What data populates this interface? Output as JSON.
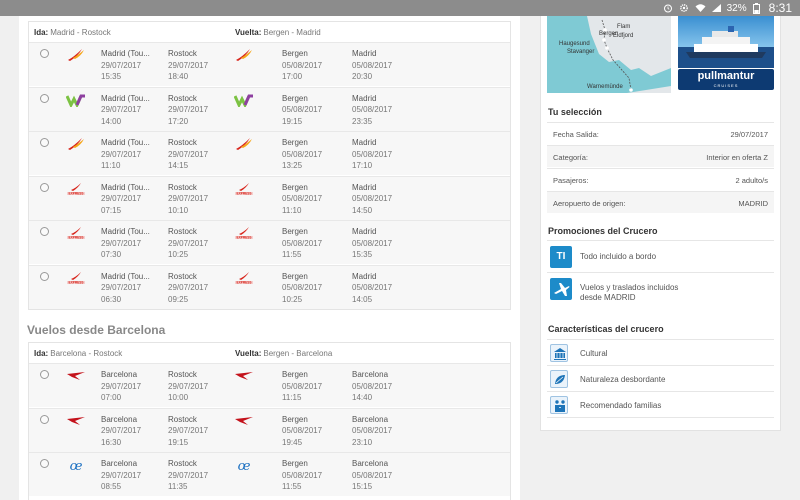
{
  "status_bar": {
    "battery": "32%",
    "time": "8:31"
  },
  "madrid_panel": {
    "ida_label": "Ida:",
    "ida_route": "Madrid - Rostock",
    "vuelta_label": "Vuelta:",
    "vuelta_route": "Bergen - Madrid",
    "rows": [
      {
        "airline_out": "iberia",
        "airline_ret": "iberia",
        "o_from": "Madrid (Tou...",
        "o_from_dt": "29/07/2017",
        "o_from_tm": "15:35",
        "o_to": "Rostock",
        "o_to_dt": "29/07/2017",
        "o_to_tm": "18:40",
        "r_from": "Bergen",
        "r_from_dt": "05/08/2017",
        "r_from_tm": "17:00",
        "r_to": "Madrid",
        "r_to_dt": "05/08/2017",
        "r_to_tm": "20:30"
      },
      {
        "airline_out": "vueling",
        "airline_ret": "vueling",
        "o_from": "Madrid (Tou...",
        "o_from_dt": "29/07/2017",
        "o_from_tm": "14:00",
        "o_to": "Rostock",
        "o_to_dt": "29/07/2017",
        "o_to_tm": "17:20",
        "r_from": "Bergen",
        "r_from_dt": "05/08/2017",
        "r_from_tm": "19:15",
        "r_to": "Madrid",
        "r_to_dt": "05/08/2017",
        "r_to_tm": "23:35"
      },
      {
        "airline_out": "iberia",
        "airline_ret": "iberia",
        "o_from": "Madrid (Tou...",
        "o_from_dt": "29/07/2017",
        "o_from_tm": "11:10",
        "o_to": "Rostock",
        "o_to_dt": "29/07/2017",
        "o_to_tm": "14:15",
        "r_from": "Bergen",
        "r_from_dt": "05/08/2017",
        "r_from_tm": "13:25",
        "r_to": "Madrid",
        "r_to_dt": "05/08/2017",
        "r_to_tm": "17:10"
      },
      {
        "airline_out": "iberia-express",
        "airline_ret": "iberia-express",
        "o_from": "Madrid (Tou...",
        "o_from_dt": "29/07/2017",
        "o_from_tm": "07:15",
        "o_to": "Rostock",
        "o_to_dt": "29/07/2017",
        "o_to_tm": "10:10",
        "r_from": "Bergen",
        "r_from_dt": "05/08/2017",
        "r_from_tm": "11:10",
        "r_to": "Madrid",
        "r_to_dt": "05/08/2017",
        "r_to_tm": "14:50"
      },
      {
        "airline_out": "iberia-express",
        "airline_ret": "iberia-express",
        "o_from": "Madrid (Tou...",
        "o_from_dt": "29/07/2017",
        "o_from_tm": "07:30",
        "o_to": "Rostock",
        "o_to_dt": "29/07/2017",
        "o_to_tm": "10:25",
        "r_from": "Bergen",
        "r_from_dt": "05/08/2017",
        "r_from_tm": "11:55",
        "r_to": "Madrid",
        "r_to_dt": "05/08/2017",
        "r_to_tm": "15:35"
      },
      {
        "airline_out": "iberia-express",
        "airline_ret": "iberia-express",
        "o_from": "Madrid (Tou...",
        "o_from_dt": "29/07/2017",
        "o_from_tm": "06:30",
        "o_to": "Rostock",
        "o_to_dt": "29/07/2017",
        "o_to_tm": "09:25",
        "r_from": "Bergen",
        "r_from_dt": "05/08/2017",
        "r_from_tm": "10:25",
        "r_to": "Madrid",
        "r_to_dt": "05/08/2017",
        "r_to_tm": "14:05"
      }
    ]
  },
  "barcelona_section_title": "Vuelos desde Barcelona",
  "barcelona_panel": {
    "ida_label": "Ida:",
    "ida_route": "Barcelona - Rostock",
    "vuelta_label": "Vuelta:",
    "vuelta_route": "Bergen - Barcelona",
    "rows": [
      {
        "airline_out": "air-europa-red",
        "airline_ret": "air-europa-red",
        "o_from": "Barcelona",
        "o_from_dt": "29/07/2017",
        "o_from_tm": "07:00",
        "o_to": "Rostock",
        "o_to_dt": "29/07/2017",
        "o_to_tm": "10:00",
        "r_from": "Bergen",
        "r_from_dt": "05/08/2017",
        "r_from_tm": "11:15",
        "r_to": "Barcelona",
        "r_to_dt": "05/08/2017",
        "r_to_tm": "14:40"
      },
      {
        "airline_out": "air-europa-red",
        "airline_ret": "air-europa-red",
        "o_from": "Barcelona",
        "o_from_dt": "29/07/2017",
        "o_from_tm": "16:30",
        "o_to": "Rostock",
        "o_to_dt": "29/07/2017",
        "o_to_tm": "19:15",
        "r_from": "Bergen",
        "r_from_dt": "05/08/2017",
        "r_from_tm": "19:45",
        "r_to": "Barcelona",
        "r_to_dt": "05/08/2017",
        "r_to_tm": "23:10"
      },
      {
        "airline_out": "air-europa",
        "airline_ret": "air-europa",
        "o_from": "Barcelona",
        "o_from_dt": "29/07/2017",
        "o_from_tm": "08:55",
        "o_to": "Rostock",
        "o_to_dt": "29/07/2017",
        "o_to_tm": "11:35",
        "r_from": "Bergen",
        "r_from_dt": "05/08/2017",
        "r_from_tm": "11:55",
        "r_to": "Barcelona",
        "r_to_dt": "05/08/2017",
        "r_to_tm": "15:15"
      }
    ]
  },
  "sidebar": {
    "map_labels": [
      "Flam",
      "Bergen",
      "Eidfjord",
      "Haugesund",
      "Stavanger",
      "Warnemünde"
    ],
    "brand_name": "pullmantur",
    "brand_sub": "CRUISES",
    "selection_title": "Tu selección",
    "selection": [
      {
        "k": "Fecha Salida:",
        "v": "29/07/2017"
      },
      {
        "k": "Categoría:",
        "v": "Interior en oferta Z"
      },
      {
        "k": "Pasajeros:",
        "v": "2 adulto/s"
      },
      {
        "k": "Aeropuerto de origen:",
        "v": "MADRID"
      }
    ],
    "promos_title": "Promociones del Crucero",
    "promo_ti_icon": "TI",
    "promo_1": "Todo incluido a bordo",
    "promo_2_line1": "Vuelos y traslados incluidos",
    "promo_2_line2": "desde MADRID",
    "features_title": "Características del crucero",
    "features": [
      "Cultural",
      "Naturaleza desbordante",
      "Recomendado familias"
    ]
  }
}
